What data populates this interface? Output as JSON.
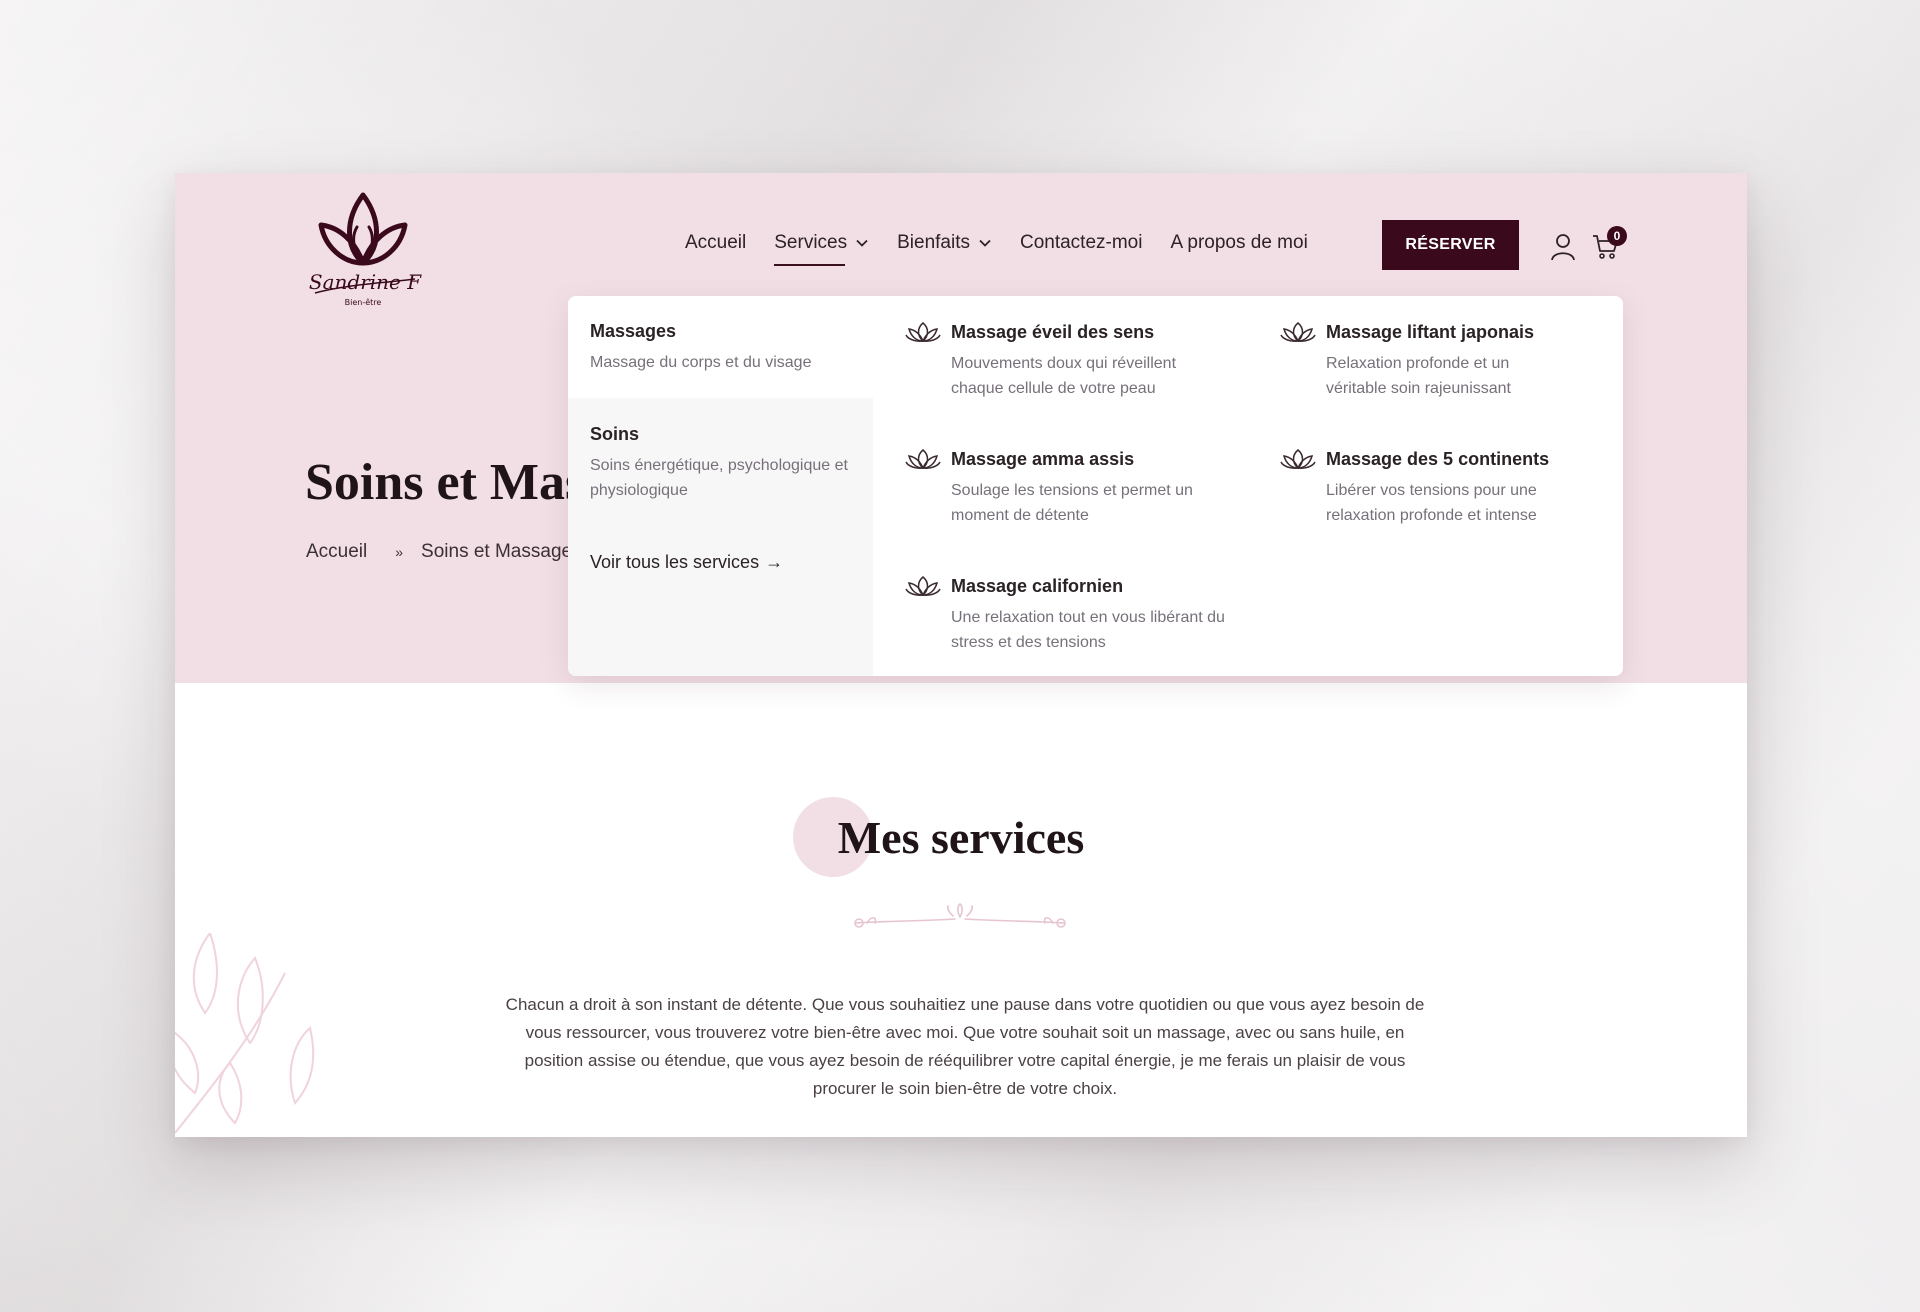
{
  "brand": {
    "logo_script": "Sandrine F",
    "logo_tagline": "Bien-être",
    "color_primary": "#3a0a1c",
    "color_hero_bg": "#f2dfe6"
  },
  "nav": {
    "items": [
      {
        "label": "Accueil",
        "has_dropdown": false
      },
      {
        "label": "Services",
        "has_dropdown": true,
        "active": true
      },
      {
        "label": "Bienfaits",
        "has_dropdown": true
      },
      {
        "label": "Contactez-moi",
        "has_dropdown": false
      },
      {
        "label": "A propos de moi",
        "has_dropdown": false
      }
    ],
    "reserve_label": "RÉSERVER",
    "account_icon": "user-icon",
    "cart_icon": "cart-icon",
    "cart_count": "0"
  },
  "hero": {
    "title": "Soins et Massages",
    "breadcrumb": [
      {
        "label": "Accueil"
      },
      {
        "label": "Soins et Massages"
      }
    ],
    "breadcrumb_sep": "»"
  },
  "mega_menu": {
    "categories": [
      {
        "title": "Massages",
        "desc": "Massage du corps et du visage",
        "selected": true
      },
      {
        "title": "Soins",
        "desc": "Soins énergétique, psychologique et physiologique",
        "selected": false
      }
    ],
    "view_all_label": "Voir tous les services",
    "view_all_arrow": "→",
    "services": [
      {
        "title": "Massage éveil des sens",
        "desc": "Mouvements doux qui réveillent chaque cellule de votre peau",
        "icon": "lotus-icon"
      },
      {
        "title": "Massage liftant japonais",
        "desc": "Relaxation profonde et un véritable soin rajeunissant",
        "icon": "lotus-icon"
      },
      {
        "title": "Massage amma assis",
        "desc": "Soulage les tensions et permet un moment de détente",
        "icon": "lotus-icon"
      },
      {
        "title": "Massage des 5 continents",
        "desc": "Libérer vos tensions pour une relaxation profonde et intense",
        "icon": "lotus-icon"
      },
      {
        "title": "Massage californien",
        "desc": "Une relaxation tout en vous libérant du stress et des tensions",
        "icon": "lotus-icon"
      }
    ]
  },
  "services_section": {
    "title": "Mes services",
    "intro": "Chacun a droit à son instant de détente. Que vous souhaitiez une pause dans votre quotidien ou que vous ayez besoin de vous ressourcer, vous trouverez votre bien-être avec moi. Que votre souhait soit un massage, avec ou sans huile, en position assise ou étendue, que vous ayez besoin de rééquilibrer votre capital énergie, je me ferais un plaisir de vous procurer le soin bien-être de votre choix."
  }
}
